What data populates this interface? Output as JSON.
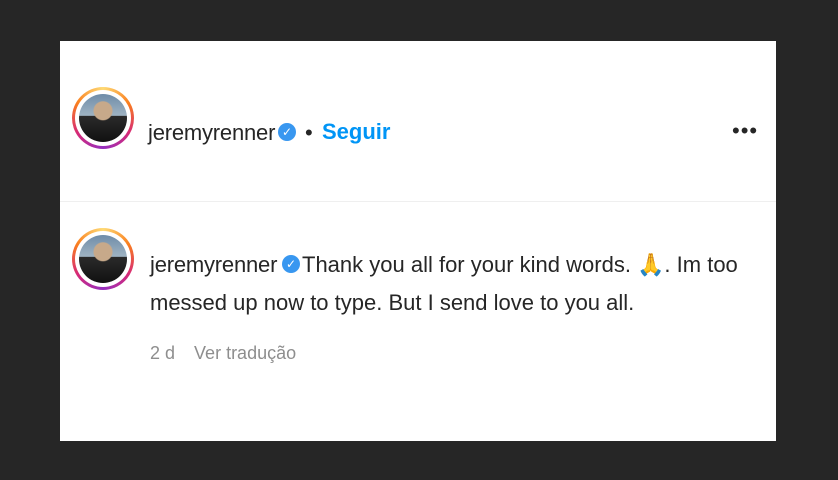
{
  "post_header": {
    "username": "jeremyrenner",
    "separator": "•",
    "follow_label": "Seguir",
    "more_label": "•••"
  },
  "comment": {
    "username": "jeremyrenner",
    "text": "Thank you all for your kind words. 🙏. Im too messed up now to type. But I send love to you all.",
    "time": "2 d",
    "translate_label": "Ver tradução"
  },
  "colors": {
    "follow": "#0095f6",
    "verified": "#3897f0",
    "text": "#262626",
    "meta": "#8e8e8e"
  },
  "icons": {
    "verified": "verified-badge-icon",
    "more": "more-options-icon"
  }
}
